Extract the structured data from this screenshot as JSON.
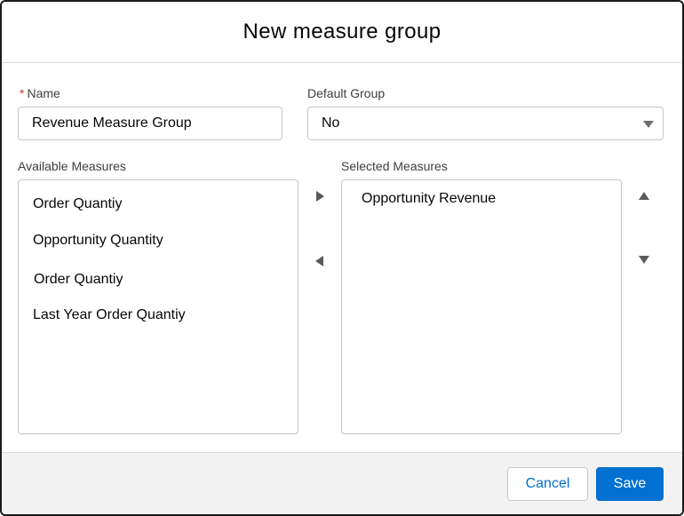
{
  "dialog": {
    "title": "New measure group"
  },
  "form": {
    "name_required_marker": "*",
    "name_label": "Name",
    "name_value": "Revenue Measure Group",
    "default_group_label": "Default Group",
    "default_group_value": "No"
  },
  "available": {
    "label": "Available Measures",
    "items": [
      "Order Quantiy",
      "Opportunity Quantity",
      "Order Quantiy",
      "Last Year  Order Quantiy"
    ]
  },
  "selected": {
    "label": "Selected Measures",
    "items": [
      "Opportunity Revenue"
    ]
  },
  "icons": {
    "move_right": "chevron-right-icon",
    "move_left": "chevron-left-icon",
    "move_up": "chevron-up-icon",
    "move_down": "chevron-down-icon",
    "select_arrow": "caret-down-icon"
  },
  "footer": {
    "cancel_label": "Cancel",
    "save_label": "Save"
  },
  "colors": {
    "brand": "#0070d2",
    "required": "#c23934",
    "footer_bg": "#f3f2f2"
  }
}
